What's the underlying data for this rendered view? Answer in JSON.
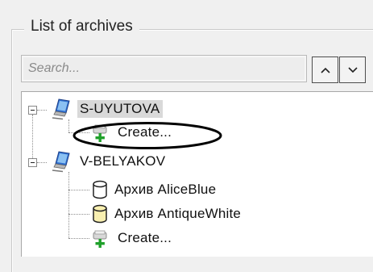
{
  "group": {
    "title": "List of archives"
  },
  "search": {
    "placeholder": "Search...",
    "value": ""
  },
  "nav": {
    "up_icon": "chevron-up-icon",
    "down_icon": "chevron-down-icon"
  },
  "tree": {
    "servers": [
      {
        "name": "S-UYUTOVA",
        "icon": "computer-icon",
        "expanded": true,
        "selected": true,
        "children": [
          {
            "label": "Create...",
            "icon": "create-archive-icon"
          }
        ]
      },
      {
        "name": "V-BELYAKOV",
        "icon": "computer-icon",
        "expanded": true,
        "selected": false,
        "children": [
          {
            "label": "Архив AliceBlue",
            "icon": "archive-cylinder-icon",
            "color": "#ffffff"
          },
          {
            "label": "Архив AntiqueWhite",
            "icon": "archive-cylinder-icon",
            "color": "#f8efb0"
          },
          {
            "label": "Create...",
            "icon": "create-archive-icon"
          }
        ]
      }
    ]
  },
  "colors": {
    "selection": "#d9d9d9",
    "create_plus": "#1fa02a",
    "highlight_ellipse": "#000000"
  }
}
